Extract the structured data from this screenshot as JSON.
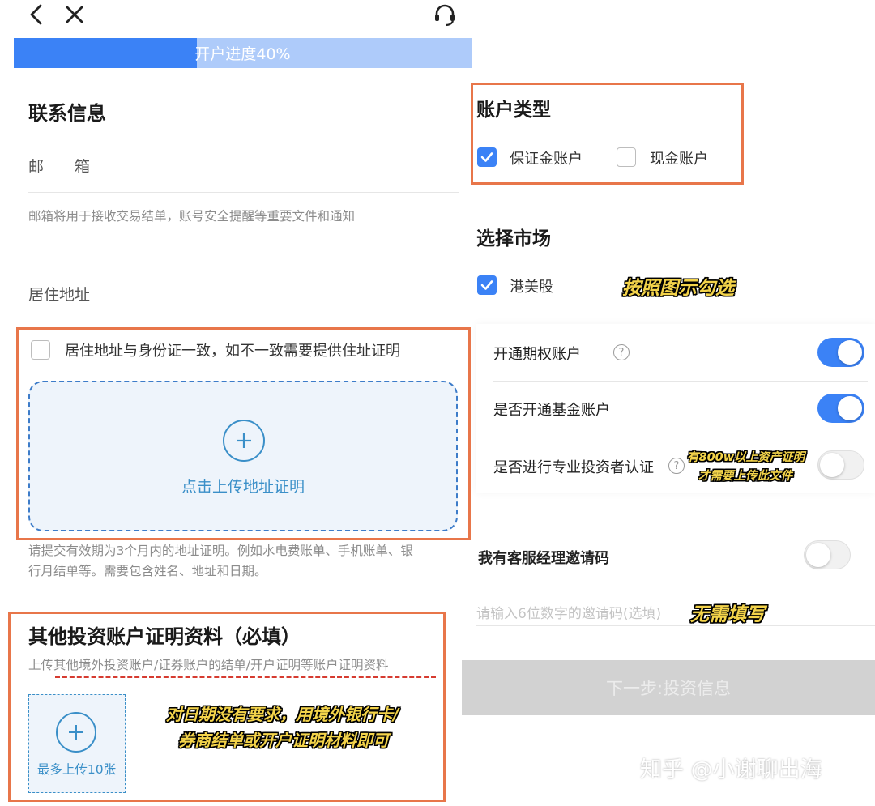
{
  "progress": {
    "label": "开户进度40%",
    "value_percent": 40
  },
  "contact": {
    "title": "联系信息",
    "email_label": "邮　　箱",
    "email_hint": "邮箱将用于接收交易结单，账号安全提醒等重要文件和通知",
    "address_label": "居住地址",
    "address_same_label": "居住地址与身份证一致，如不一致需要提供住址证明",
    "upload_label": "点击上传地址证明",
    "address_hint_line1": "请提交有效期为3个月内的地址证明。例如水电费账单、手机账单、银",
    "address_hint_line2": "行月结单等。需要包含姓名、地址和日期。"
  },
  "other_proof": {
    "title": "其他投资账户证明资料（必填）",
    "hint": "上传其他境外投资账户/证券账户的结单/开户证明等账户证明资料",
    "upload_label": "最多上传10张",
    "annotation_line1": "对日期没有要求，用境外银行卡/",
    "annotation_line2": "券商结单或开户证明材料即可"
  },
  "account_type": {
    "title": "账户类型",
    "options": [
      {
        "label": "保证金账户",
        "checked": true
      },
      {
        "label": "现金账户",
        "checked": false
      }
    ]
  },
  "market": {
    "title": "选择市场",
    "option_label": "港美股",
    "checked": true,
    "annotation": "按照图示勾选"
  },
  "toggles": [
    {
      "label": "开通期权账户",
      "on": true
    },
    {
      "label": "是否开通基金账户",
      "on": true
    },
    {
      "label": "是否进行专业投资者认证",
      "on": false
    }
  ],
  "pro_annotation": {
    "line1": "有800w以上资产证明",
    "line2": "才需要上传此文件"
  },
  "invite": {
    "label": "我有客服经理邀请码",
    "on": false,
    "placeholder": "请输入6位数字的邀请码(选填)",
    "annotation": "无需填写"
  },
  "next_button": "下一步:投资信息",
  "watermark": "知乎 @小谢聊出海",
  "colors": {
    "accent": "#3b82f6",
    "highlight_box": "#e8764a",
    "annotation": "#f3d34a"
  },
  "icons": [
    "back-icon",
    "close-icon",
    "headset-icon",
    "plus-icon",
    "check-icon",
    "question-icon"
  ]
}
